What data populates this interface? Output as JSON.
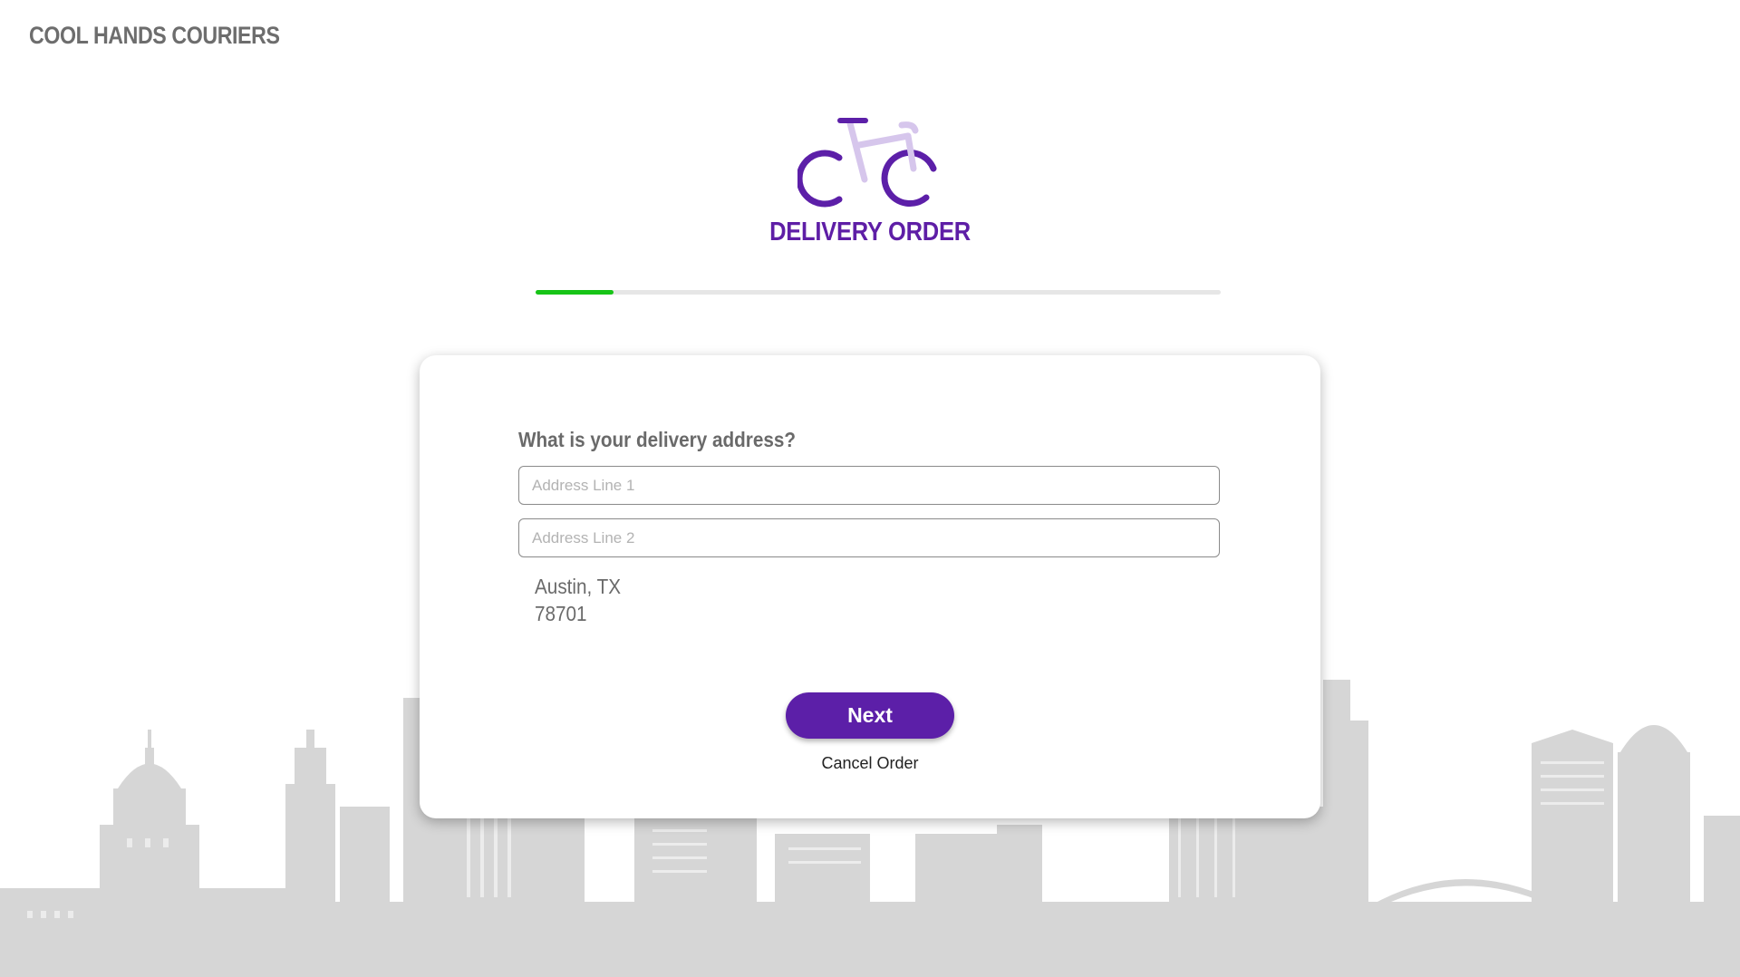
{
  "brand": {
    "name": "COOL HANDS COURIERS"
  },
  "header": {
    "logo_icon": "bicycle-icon",
    "title": "DELIVERY ORDER",
    "title_color": "#5e1ea6"
  },
  "progress": {
    "fraction": 0.114,
    "fill_color": "#17c417"
  },
  "form": {
    "question": "What is your delivery address?",
    "address_line_1": {
      "value": "",
      "placeholder": "Address Line 1"
    },
    "address_line_2": {
      "value": "",
      "placeholder": "Address Line 2"
    },
    "city_state": "Austin, TX",
    "zip": "78701",
    "next_label": "Next",
    "cancel_label": "Cancel Order"
  },
  "colors": {
    "accent": "#5c1fa8",
    "skyline": "#d4d4d4"
  }
}
